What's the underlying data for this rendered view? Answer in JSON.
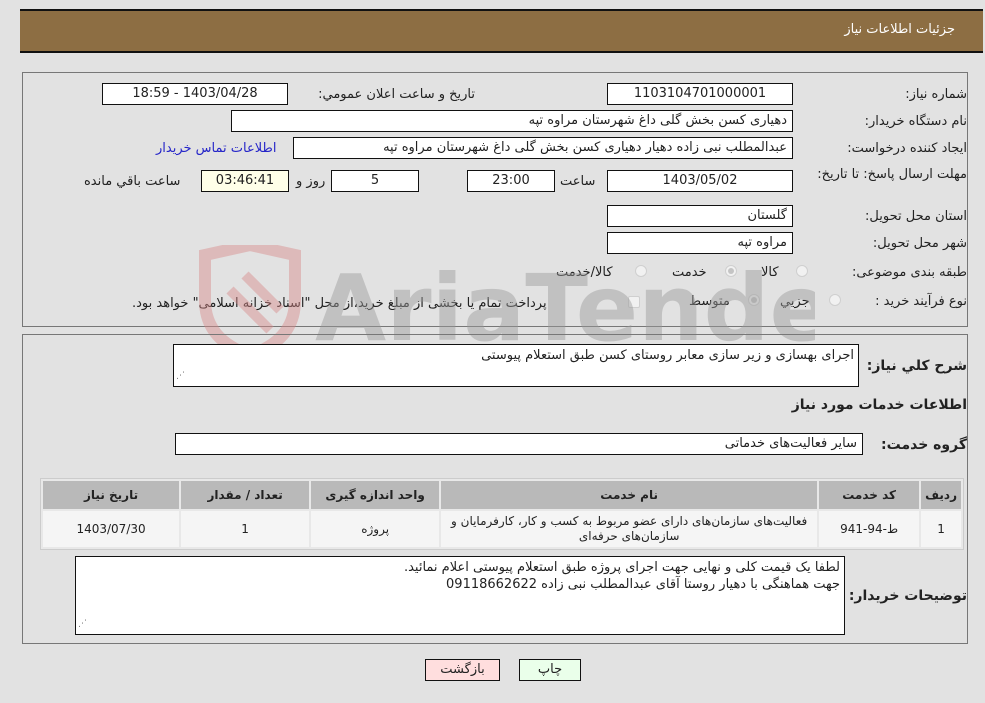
{
  "header": {
    "title": "جزئیات اطلاعات نیاز"
  },
  "form": {
    "need_number": {
      "label": "شماره نیاز:",
      "value": "1103104701000001"
    },
    "announce_datetime": {
      "label": "تاریخ و ساعت اعلان عمومي:",
      "value": "1403/04/28 - 18:59"
    },
    "buyer_org": {
      "label": "نام دستگاه خريدار:",
      "value": "دهیاری کسن بخش گلی داغ شهرستان مراوه تپه"
    },
    "requester": {
      "label": "ایجاد کننده درخواست:",
      "value": "عبدالمطلب نبی زاده دهیار دهیاری کسن بخش گلی داغ شهرستان مراوه تپه"
    },
    "buyer_contact_link": "اطلاعات تماس خریدار",
    "deadline": {
      "label": "مهلت ارسال پاسخ: تا تاریخ:",
      "date": "1403/05/02",
      "time_label": "ساعت",
      "time": "23:00",
      "days": "5",
      "days_label": "روز و",
      "remaining": "03:46:41",
      "remaining_label": "ساعت باقي مانده"
    },
    "province": {
      "label": "استان محل تحویل:",
      "value": "گلستان"
    },
    "city": {
      "label": "شهر محل تحویل:",
      "value": "مراوه تپه"
    },
    "category": {
      "label": "طبقه بندی موضوعی:",
      "options": [
        "کالا",
        "خدمت",
        "کالا/خدمت"
      ],
      "selected": "خدمت"
    },
    "purchase_type": {
      "label": "نوع فرآیند خرید :",
      "options": [
        "جزيي",
        "متوسط"
      ],
      "selected": "متوسط",
      "treasury_note": "پرداخت تمام یا بخشی از مبلغ خرید،از محل \"اسناد خزانه اسلامی\" خواهد بود."
    }
  },
  "details": {
    "general_desc_label": "شرح کلي نياز:",
    "general_desc": "اجرای بهسازی و زیر سازی معابر روستای کسن طبق استعلام پیوستی",
    "services_title": "اطلاعات خدمات مورد نیاز",
    "service_group_label": "گروه خدمت:",
    "service_group": "سایر فعالیت‌های خدماتی",
    "table": {
      "headers": [
        "رديف",
        "کد خدمت",
        "نام خدمت",
        "واحد اندازه گیری",
        "تعداد / مقدار",
        "تاریخ نیاز"
      ],
      "rows": [
        [
          "1",
          "ط-94-941",
          "فعالیت‌های سازمان‌های دارای عضو مربوط به کسب و کار، کارفرمایان و سازمان‌های حرفه‌ای",
          "پروژه",
          "1",
          "1403/07/30"
        ]
      ]
    },
    "buyer_notes_label": "توضیحات خریدار:",
    "buyer_notes_line1": "لطفا یک قیمت کلی و نهایی جهت اجرای پروژه طبق استعلام پیوستی اعلام نمائید.",
    "buyer_notes_line2": "جهت هماهنگی با دهیار روستا آقای عبدالمطلب نبی زاده 09118662622"
  },
  "buttons": {
    "print": "چاپ",
    "back": "بازگشت"
  },
  "watermark": {
    "text": "AriaTender.neT"
  },
  "colors": {
    "header_bg": "#8d6e43",
    "print_bg": "#eaffea",
    "back_bg": "#ffdede",
    "link": "#2525c8"
  }
}
